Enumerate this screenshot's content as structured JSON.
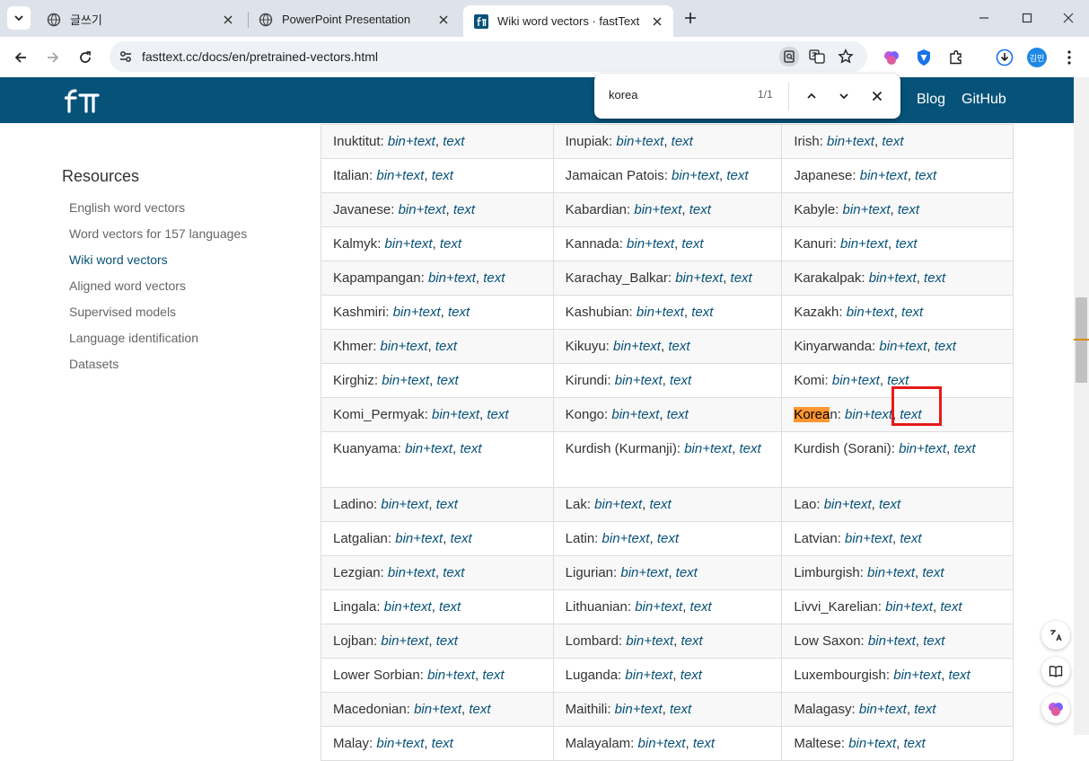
{
  "browser": {
    "tabs": [
      {
        "title": "글쓰기",
        "active": false
      },
      {
        "title": "PowerPoint Presentation",
        "active": false
      },
      {
        "title": "Wiki word vectors · fastText",
        "active": true
      }
    ],
    "url": "fasttext.cc/docs/en/pretrained-vectors.html",
    "profile_label": "김민"
  },
  "find_bar": {
    "query": "korea",
    "count": "1/1"
  },
  "header": {
    "links": [
      "Blog",
      "GitHub"
    ]
  },
  "sidebar": {
    "heading": "Resources",
    "items": [
      {
        "label": "English word vectors",
        "active": false
      },
      {
        "label": "Word vectors for 157 languages",
        "active": false
      },
      {
        "label": "Wiki word vectors",
        "active": true
      },
      {
        "label": "Aligned word vectors",
        "active": false
      },
      {
        "label": "Supervised models",
        "active": false
      },
      {
        "label": "Language identification",
        "active": false
      },
      {
        "label": "Datasets",
        "active": false
      }
    ]
  },
  "table": {
    "link_bin": "bin+text",
    "link_text": "text",
    "rows": [
      [
        "Inuktitut",
        "Inupiak",
        "Irish"
      ],
      [
        "Italian",
        "Jamaican Patois",
        "Japanese"
      ],
      [
        "Javanese",
        "Kabardian",
        "Kabyle"
      ],
      [
        "Kalmyk",
        "Kannada",
        "Kanuri"
      ],
      [
        "Kapampangan",
        "Karachay_Balkar",
        "Karakalpak"
      ],
      [
        "Kashmiri",
        "Kashubian",
        "Kazakh"
      ],
      [
        "Khmer",
        "Kikuyu",
        "Kinyarwanda"
      ],
      [
        "Kirghiz",
        "Kirundi",
        "Komi"
      ],
      [
        "Komi_Permyak",
        "Kongo",
        "Korean"
      ],
      [
        "Kuanyama",
        "Kurdish (Kurmanji)",
        "Kurdish (Sorani)"
      ],
      [
        "Ladino",
        "Lak",
        "Lao"
      ],
      [
        "Latgalian",
        "Latin",
        "Latvian"
      ],
      [
        "Lezgian",
        "Ligurian",
        "Limburgish"
      ],
      [
        "Lingala",
        "Lithuanian",
        "Livvi_Karelian"
      ],
      [
        "Lojban",
        "Lombard",
        "Low Saxon"
      ],
      [
        "Lower Sorbian",
        "Luganda",
        "Luxembourgish"
      ],
      [
        "Macedonian",
        "Maithili",
        "Malagasy"
      ],
      [
        "Malay",
        "Malayalam",
        "Maltese"
      ]
    ]
  },
  "colors": {
    "brand": "#075279",
    "find_highlight": "#ff9632",
    "annotation_box": "#e51b1b"
  }
}
